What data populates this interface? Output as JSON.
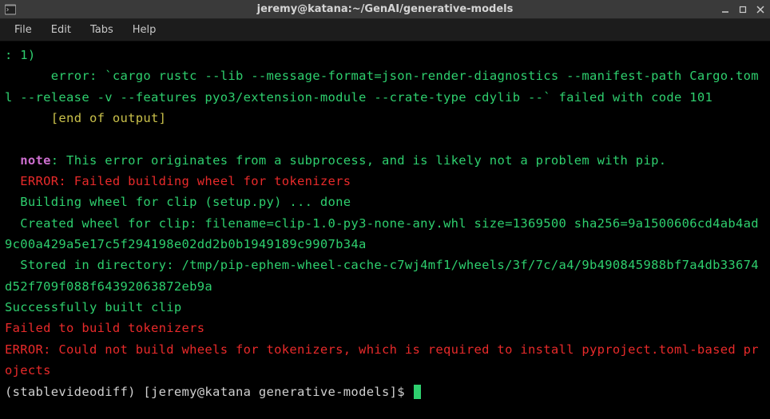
{
  "titlebar": {
    "title": "jeremy@katana:~/GenAI/generative-models"
  },
  "menubar": {
    "file": "File",
    "edit": "Edit",
    "tabs": "Tabs",
    "help": "Help"
  },
  "terminal": {
    "line1": ": 1)",
    "line2_prefix": "      error: ",
    "line2_cmd": "`cargo rustc --lib --message-format=json-render-diagnostics --manifest-path Cargo.toml --release -v --features pyo3/extension-module --crate-type cdylib --`",
    "line2_suffix": " failed with code 101",
    "line3": "      [end of output]",
    "note_label": "note",
    "note_text": ": This error originates from a subprocess, and is likely not a problem with pip.",
    "err_wheel": "  ERROR: Failed building wheel for tokenizers",
    "build_clip": "  Building wheel for clip (setup.py) ... done",
    "created_wheel": "  Created wheel for clip: filename=clip-1.0-py3-none-any.whl size=1369500 sha256=9a1500606cd4ab4ad9c00a429a5e17c5f294198e02dd2b0b1949189c9907b34a",
    "stored_dir": "  Stored in directory: /tmp/pip-ephem-wheel-cache-c7wj4mf1/wheels/3f/7c/a4/9b490845988bf7a4db33674d52f709f088f64392063872eb9a",
    "success": "Successfully built clip",
    "fail_build": "Failed to build tokenizers",
    "err_final": "ERROR: Could not build wheels for tokenizers, which is required to install pyproject.toml-based projects",
    "prompt_env": "(stablevideodiff) ",
    "prompt_userhost": "[jeremy@katana generative-models]$ "
  }
}
